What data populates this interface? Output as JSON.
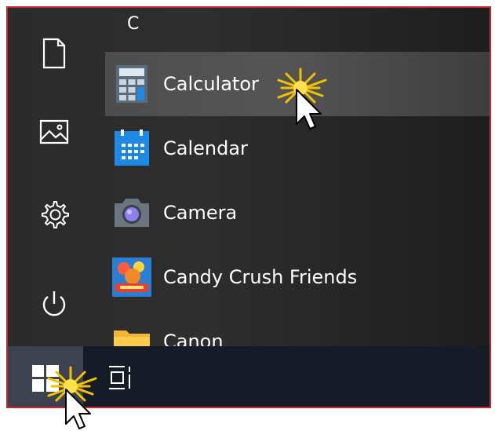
{
  "start_menu": {
    "section_letter": "C",
    "apps": [
      {
        "label": "Calculator",
        "icon": "calculator-icon",
        "highlighted": true
      },
      {
        "label": "Calendar",
        "icon": "calendar-icon"
      },
      {
        "label": "Camera",
        "icon": "camera-icon"
      },
      {
        "label": "Candy Crush Friends",
        "icon": "candy-crush-icon"
      },
      {
        "label": "Canon",
        "icon": "folder-icon"
      }
    ]
  },
  "left_rail": [
    "document-icon",
    "pictures-icon",
    "settings-icon",
    "power-icon"
  ],
  "taskbar": {
    "start": "windows-logo-icon",
    "task_view": "task-view-icon"
  },
  "colors": {
    "accent_blue": "#1e88e5",
    "callout_red": "#c8242b",
    "sparkle_gold": "#f2c200"
  }
}
